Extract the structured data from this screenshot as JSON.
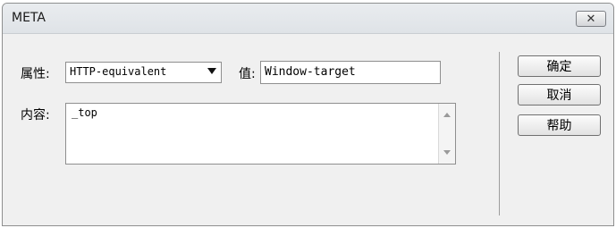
{
  "window": {
    "title": "META",
    "close_glyph": "✕"
  },
  "attribute": {
    "label": "属性:",
    "selected": "HTTP-equivalent"
  },
  "value": {
    "label": "值:",
    "text": "Window-target"
  },
  "content": {
    "label": "内容:",
    "text": "_top"
  },
  "buttons": {
    "ok": "确定",
    "cancel": "取消",
    "help": "帮助"
  }
}
